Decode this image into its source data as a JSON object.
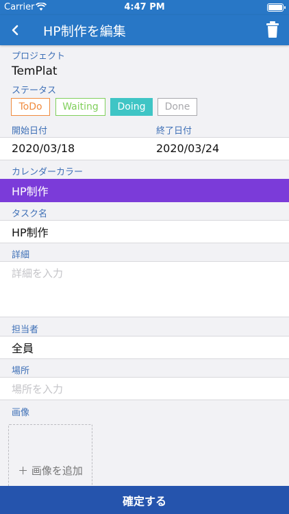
{
  "status_bar": {
    "carrier": "Carrier",
    "time": "4:47 PM"
  },
  "nav": {
    "title": "HP制作を編集",
    "back_icon": "chevron-left-icon",
    "delete_icon": "trash-icon"
  },
  "project": {
    "label": "プロジェクト",
    "value": "TemPlat"
  },
  "status": {
    "label": "ステータス",
    "options": [
      {
        "label": "ToDo",
        "color": "#f08a3c"
      },
      {
        "label": "Waiting",
        "color": "#7fcf5a"
      },
      {
        "label": "Doing",
        "color": "#3fc5c5"
      },
      {
        "label": "Done",
        "color": "#a8a8ac"
      }
    ],
    "selected": "Doing"
  },
  "dates": {
    "start_label": "開始日付",
    "start_value": "2020/03/18",
    "end_label": "終了日付",
    "end_value": "2020/03/24"
  },
  "calendar_color": {
    "label": "カレンダーカラー",
    "value": "HP制作",
    "color": "#7b3bd9"
  },
  "task_name": {
    "label": "タスク名",
    "value": "HP制作"
  },
  "details": {
    "label": "詳細",
    "placeholder": "詳細を入力"
  },
  "assignee": {
    "label": "担当者",
    "value": "全員"
  },
  "location": {
    "label": "場所",
    "placeholder": "場所を入力"
  },
  "image": {
    "label": "画像",
    "add_label": "＋ 画像を追加"
  },
  "confirm_label": "確定する"
}
